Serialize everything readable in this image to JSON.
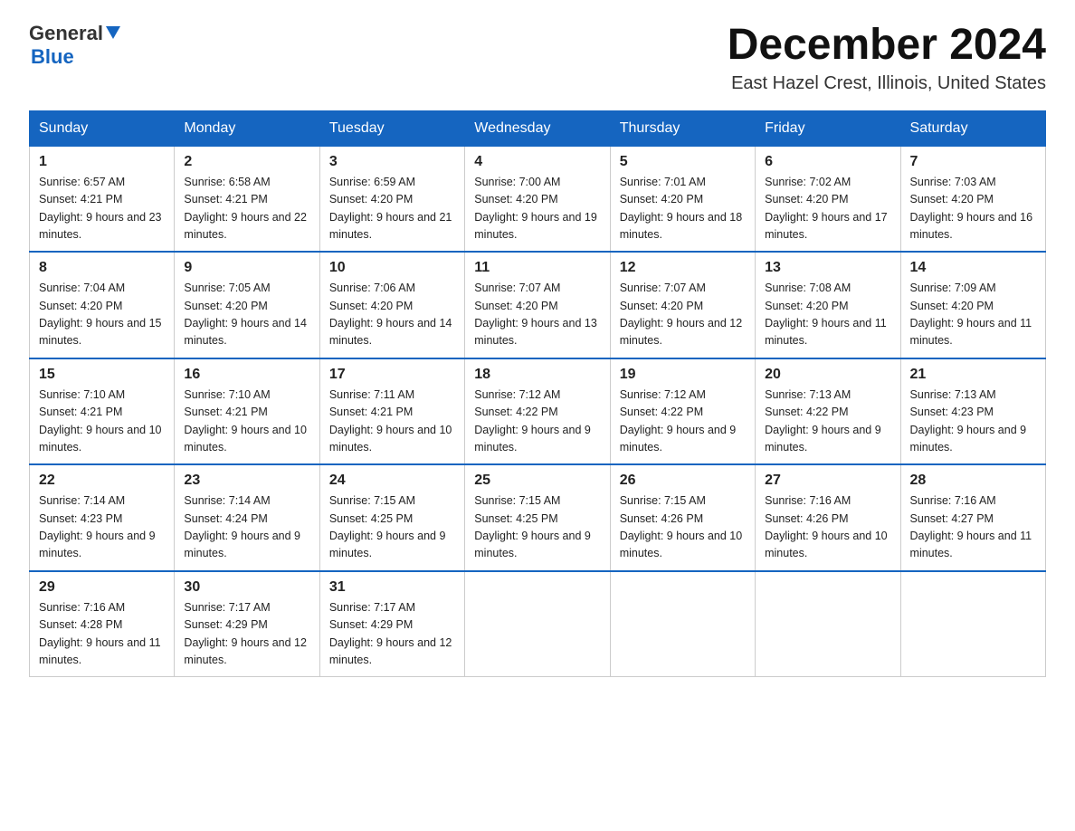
{
  "header": {
    "logo_general": "General",
    "logo_blue": "Blue",
    "month_title": "December 2024",
    "location": "East Hazel Crest, Illinois, United States"
  },
  "weekdays": [
    "Sunday",
    "Monday",
    "Tuesday",
    "Wednesday",
    "Thursday",
    "Friday",
    "Saturday"
  ],
  "weeks": [
    [
      {
        "day": "1",
        "sunrise": "6:57 AM",
        "sunset": "4:21 PM",
        "daylight": "9 hours and 23 minutes."
      },
      {
        "day": "2",
        "sunrise": "6:58 AM",
        "sunset": "4:21 PM",
        "daylight": "9 hours and 22 minutes."
      },
      {
        "day": "3",
        "sunrise": "6:59 AM",
        "sunset": "4:20 PM",
        "daylight": "9 hours and 21 minutes."
      },
      {
        "day": "4",
        "sunrise": "7:00 AM",
        "sunset": "4:20 PM",
        "daylight": "9 hours and 19 minutes."
      },
      {
        "day": "5",
        "sunrise": "7:01 AM",
        "sunset": "4:20 PM",
        "daylight": "9 hours and 18 minutes."
      },
      {
        "day": "6",
        "sunrise": "7:02 AM",
        "sunset": "4:20 PM",
        "daylight": "9 hours and 17 minutes."
      },
      {
        "day": "7",
        "sunrise": "7:03 AM",
        "sunset": "4:20 PM",
        "daylight": "9 hours and 16 minutes."
      }
    ],
    [
      {
        "day": "8",
        "sunrise": "7:04 AM",
        "sunset": "4:20 PM",
        "daylight": "9 hours and 15 minutes."
      },
      {
        "day": "9",
        "sunrise": "7:05 AM",
        "sunset": "4:20 PM",
        "daylight": "9 hours and 14 minutes."
      },
      {
        "day": "10",
        "sunrise": "7:06 AM",
        "sunset": "4:20 PM",
        "daylight": "9 hours and 14 minutes."
      },
      {
        "day": "11",
        "sunrise": "7:07 AM",
        "sunset": "4:20 PM",
        "daylight": "9 hours and 13 minutes."
      },
      {
        "day": "12",
        "sunrise": "7:07 AM",
        "sunset": "4:20 PM",
        "daylight": "9 hours and 12 minutes."
      },
      {
        "day": "13",
        "sunrise": "7:08 AM",
        "sunset": "4:20 PM",
        "daylight": "9 hours and 11 minutes."
      },
      {
        "day": "14",
        "sunrise": "7:09 AM",
        "sunset": "4:20 PM",
        "daylight": "9 hours and 11 minutes."
      }
    ],
    [
      {
        "day": "15",
        "sunrise": "7:10 AM",
        "sunset": "4:21 PM",
        "daylight": "9 hours and 10 minutes."
      },
      {
        "day": "16",
        "sunrise": "7:10 AM",
        "sunset": "4:21 PM",
        "daylight": "9 hours and 10 minutes."
      },
      {
        "day": "17",
        "sunrise": "7:11 AM",
        "sunset": "4:21 PM",
        "daylight": "9 hours and 10 minutes."
      },
      {
        "day": "18",
        "sunrise": "7:12 AM",
        "sunset": "4:22 PM",
        "daylight": "9 hours and 9 minutes."
      },
      {
        "day": "19",
        "sunrise": "7:12 AM",
        "sunset": "4:22 PM",
        "daylight": "9 hours and 9 minutes."
      },
      {
        "day": "20",
        "sunrise": "7:13 AM",
        "sunset": "4:22 PM",
        "daylight": "9 hours and 9 minutes."
      },
      {
        "day": "21",
        "sunrise": "7:13 AM",
        "sunset": "4:23 PM",
        "daylight": "9 hours and 9 minutes."
      }
    ],
    [
      {
        "day": "22",
        "sunrise": "7:14 AM",
        "sunset": "4:23 PM",
        "daylight": "9 hours and 9 minutes."
      },
      {
        "day": "23",
        "sunrise": "7:14 AM",
        "sunset": "4:24 PM",
        "daylight": "9 hours and 9 minutes."
      },
      {
        "day": "24",
        "sunrise": "7:15 AM",
        "sunset": "4:25 PM",
        "daylight": "9 hours and 9 minutes."
      },
      {
        "day": "25",
        "sunrise": "7:15 AM",
        "sunset": "4:25 PM",
        "daylight": "9 hours and 9 minutes."
      },
      {
        "day": "26",
        "sunrise": "7:15 AM",
        "sunset": "4:26 PM",
        "daylight": "9 hours and 10 minutes."
      },
      {
        "day": "27",
        "sunrise": "7:16 AM",
        "sunset": "4:26 PM",
        "daylight": "9 hours and 10 minutes."
      },
      {
        "day": "28",
        "sunrise": "7:16 AM",
        "sunset": "4:27 PM",
        "daylight": "9 hours and 11 minutes."
      }
    ],
    [
      {
        "day": "29",
        "sunrise": "7:16 AM",
        "sunset": "4:28 PM",
        "daylight": "9 hours and 11 minutes."
      },
      {
        "day": "30",
        "sunrise": "7:17 AM",
        "sunset": "4:29 PM",
        "daylight": "9 hours and 12 minutes."
      },
      {
        "day": "31",
        "sunrise": "7:17 AM",
        "sunset": "4:29 PM",
        "daylight": "9 hours and 12 minutes."
      },
      {
        "day": "",
        "sunrise": "",
        "sunset": "",
        "daylight": ""
      },
      {
        "day": "",
        "sunrise": "",
        "sunset": "",
        "daylight": ""
      },
      {
        "day": "",
        "sunrise": "",
        "sunset": "",
        "daylight": ""
      },
      {
        "day": "",
        "sunrise": "",
        "sunset": "",
        "daylight": ""
      }
    ]
  ],
  "labels": {
    "sunrise": "Sunrise: ",
    "sunset": "Sunset: ",
    "daylight": "Daylight: "
  }
}
